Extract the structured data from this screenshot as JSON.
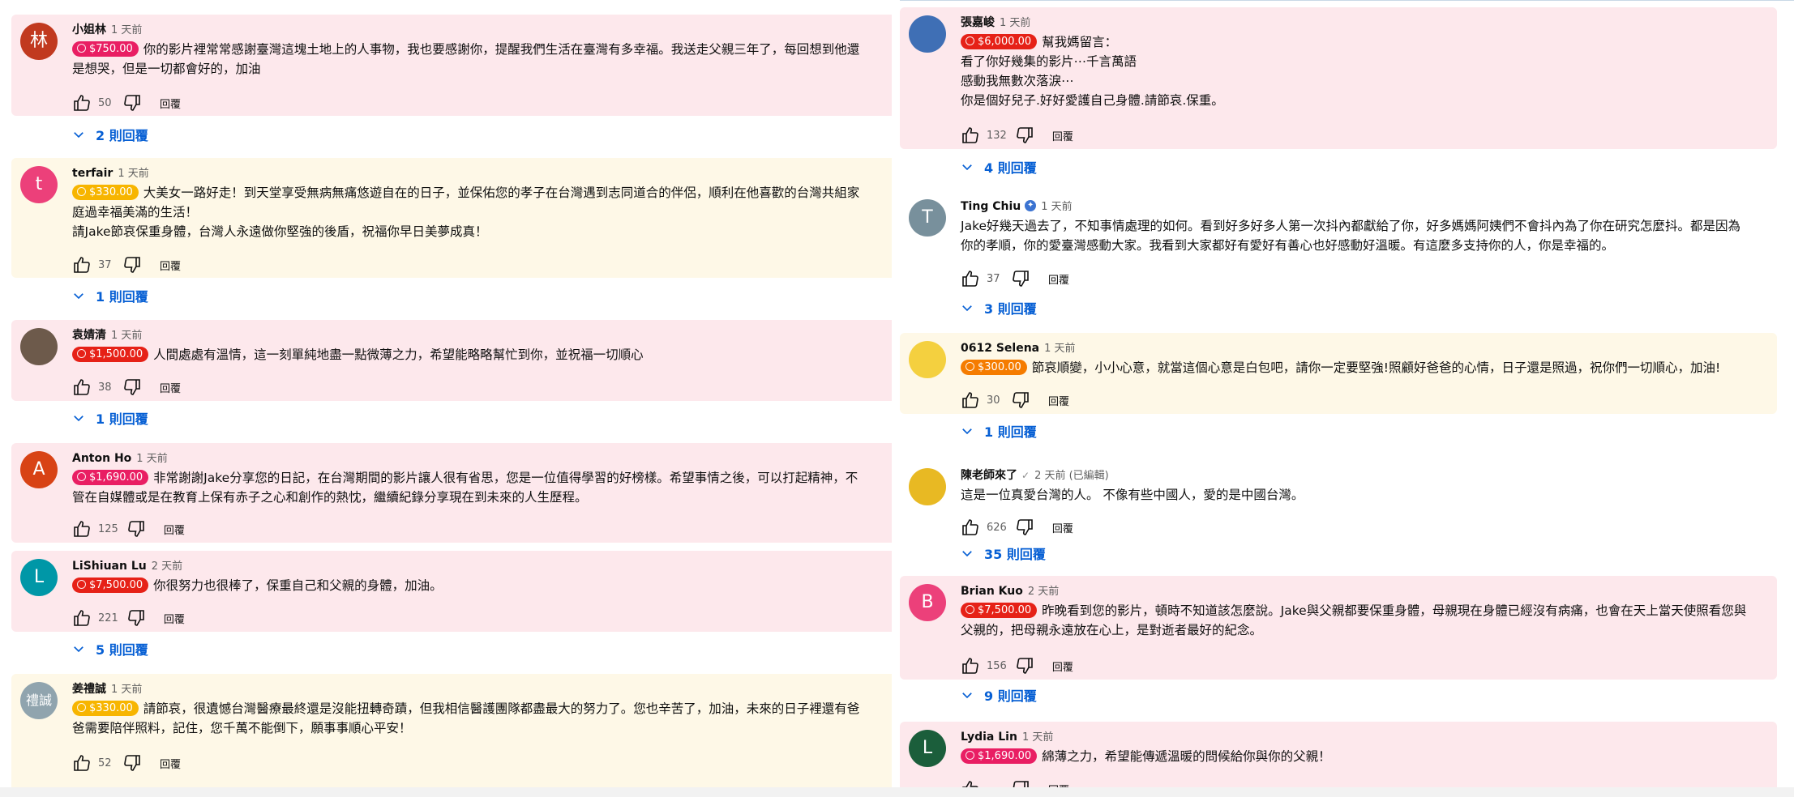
{
  "colors": {
    "pink_card": "#fde8ec",
    "yellow_card": "#fef8e7",
    "red_badge": "#e62117",
    "orange_badge": "#f57c00",
    "yellow_badge": "#f7b500",
    "pink_badge": "#e91e63",
    "link_blue": "#065fd4"
  },
  "left": {
    "comments": [
      {
        "author": "小姐林",
        "time": "1 天前",
        "avatar_letter": "林",
        "avatar_color": "#c1391f",
        "badge": "$750.00",
        "badge_color": "#e91e63",
        "text": "你的影片裡常常感謝臺灣這塊土地上的人事物，我也要感謝你，提醒我們生活在臺灣有多幸福。我送走父親三年了，每回想到他還\n是想哭，但是一切都會好的，加油",
        "likes": "50",
        "reply_label": "回覆",
        "replies": "2 則回覆"
      },
      {
        "author": "terfair",
        "time": "1 天前",
        "avatar_letter": "t",
        "avatar_color": "#ec407a",
        "badge": "$330.00",
        "badge_color": "#f7b500",
        "text": "大美女一路好走！到天堂享受無病無痛悠遊自在的日子，並保佑您的孝子在台灣遇到志同道合的伴侶，順利在他喜歡的台灣共組家\n庭過幸福美滿的生活！\n請Jake節哀保重身體，台灣人永遠做你堅強的後盾，祝福你早日美夢成真！",
        "likes": "37",
        "reply_label": "回覆",
        "replies": "1 則回覆"
      },
      {
        "author": "袁婧清",
        "time": "1 天前",
        "avatar_letter": "",
        "avatar_color": "#6d5a4b",
        "badge": "$1,500.00",
        "badge_color": "#e62117",
        "text": "人間處處有溫情，這一刻單純地盡一點微薄之力，希望能略略幫忙到你，並祝福一切順心",
        "likes": "38",
        "reply_label": "回覆",
        "replies": "1 則回覆"
      },
      {
        "author": "Anton Ho",
        "time": "1 天前",
        "avatar_letter": "A",
        "avatar_color": "#d84315",
        "badge": "$1,690.00",
        "badge_color": "#e91e63",
        "text": "非常謝謝Jake分享您的日記，在台灣期間的影片讓人很有省思，您是一位值得學習的好榜樣。希望事情之後，可以打起精神，不\n管在自媒體或是在教育上保有赤子之心和創作的熱忱，繼續紀錄分享現在到未來的人生歷程。",
        "likes": "125",
        "reply_label": "回覆",
        "replies": ""
      },
      {
        "author": "LiShiuan Lu",
        "time": "2 天前",
        "avatar_letter": "L",
        "avatar_color": "#0097a7",
        "badge": "$7,500.00",
        "badge_color": "#e62117",
        "text": "你很努力也很棒了，保重自己和父親的身體，加油。",
        "likes": "221",
        "reply_label": "回覆",
        "replies": "5 則回覆"
      },
      {
        "author": "姜禮誠",
        "time": "1 天前",
        "avatar_letter": "禮誠",
        "avatar_color": "#90a4ae",
        "badge": "$330.00",
        "badge_color": "#f7b500",
        "text": "請節哀，很遺憾台灣醫療最終還是沒能扭轉奇蹟，但我相信醫護團隊都盡最大的努力了。您也辛苦了，加油，未來的日子裡還有爸\n爸需要陪伴照料，記住，您千萬不能倒下，願事事順心平安！",
        "likes": "52",
        "reply_label": "回覆",
        "replies": ""
      }
    ]
  },
  "right": {
    "comments": [
      {
        "author": "張嘉峻",
        "time": "1 天前",
        "avatar_letter": "",
        "avatar_color": "#3f6fb5",
        "badge": "$6,000.00",
        "badge_color": "#e62117",
        "text": "幫我媽留言：\n看了你好幾集的影片⋯千言萬語\n感動我無數次落淚⋯\n你是個好兒子.好好愛護自己身體.請節哀.保重。",
        "likes": "132",
        "reply_label": "回覆",
        "replies": "4 則回覆"
      },
      {
        "author": "Ting Chiu",
        "time": "1 天前",
        "avatar_letter": "T",
        "avatar_color": "#78909c",
        "badge": "",
        "badge_color": "",
        "text": "Jake好幾天過去了，不知事情處理的如何。看到好多好多人第一次抖內都獻給了你，好多媽媽阿姨們不會抖內為了你在研究怎麼抖。都是因為\n你的孝順，你的愛臺灣感動大家。我看到大家都好有愛好有善心也好感動好溫暖。有這麼多支持你的人，你是幸福的。",
        "likes": "37",
        "reply_label": "回覆",
        "replies": "3 則回覆"
      },
      {
        "author": "0612 Selena",
        "time": "1 天前",
        "avatar_letter": "",
        "avatar_color": "#f4d03f",
        "badge": "$300.00",
        "badge_color": "#f57c00",
        "text": "節哀順變，小小心意，就當這個心意是白包吧，請你一定要堅強!照顧好爸爸的心情，日子還是照過，祝你們一切順心，加油!",
        "likes": "30",
        "reply_label": "回覆",
        "replies": "1 則回覆"
      },
      {
        "author": "陳老師來了",
        "time": "2 天前 (已編輯)",
        "avatar_letter": "",
        "avatar_color": "#e8b923",
        "badge": "",
        "badge_color": "",
        "text": "這是一位真愛台灣的人。 不像有些中國人，愛的是中國台灣。",
        "likes": "626",
        "reply_label": "回覆",
        "replies": "35 則回覆"
      },
      {
        "author": "Brian Kuo",
        "time": "2 天前",
        "avatar_letter": "B",
        "avatar_color": "#ec407a",
        "badge": "$7,500.00",
        "badge_color": "#e62117",
        "text": "昨晚看到您的影片，頓時不知道該怎麼說。Jake與父親都要保重身體，母親現在身體已經沒有病痛，也會在天上當天使照看您與\n父親的，把母親永遠放在心上，是對逝者最好的紀念。",
        "likes": "156",
        "reply_label": "回覆",
        "replies": "9 則回覆"
      },
      {
        "author": "Lydia Lin",
        "time": "1 天前",
        "avatar_letter": "L",
        "avatar_color": "#1b5e3b",
        "badge": "$1,690.00",
        "badge_color": "#e91e63",
        "text": "綿薄之力，希望能傳遞溫暖的問候給你與你的父親！",
        "likes": "",
        "reply_label": "回覆",
        "replies": ""
      }
    ]
  }
}
